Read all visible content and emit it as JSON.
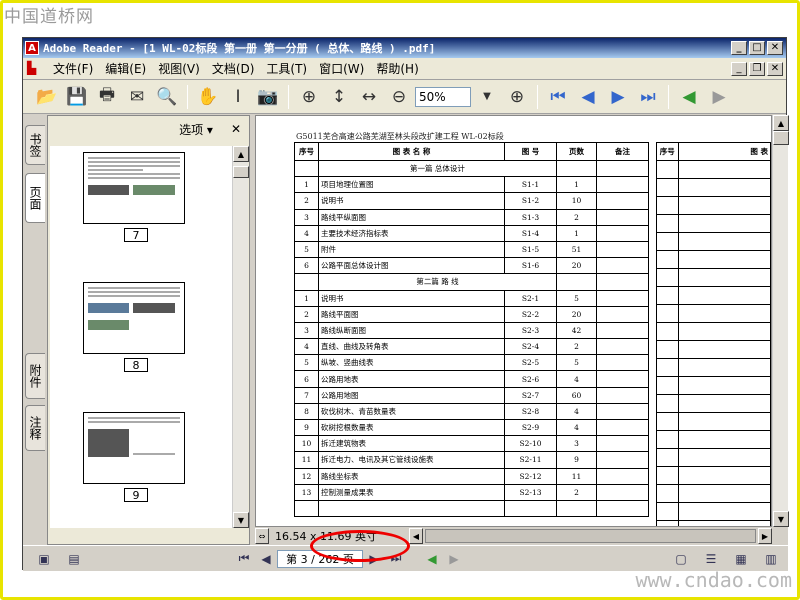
{
  "watermark": {
    "top": "中国道桥网",
    "bottom": "www.cndao.com"
  },
  "window": {
    "title": "Adobe Reader - [1 WL-02标段 第一册  第一分册 ( 总体、路线 ) .pdf]"
  },
  "menu": [
    {
      "label": "文件(F)"
    },
    {
      "label": "编辑(E)"
    },
    {
      "label": "视图(V)"
    },
    {
      "label": "文档(D)"
    },
    {
      "label": "工具(T)"
    },
    {
      "label": "窗口(W)"
    },
    {
      "label": "帮助(H)"
    }
  ],
  "toolbar": {
    "zoom": "50%"
  },
  "side_tabs": {
    "bookmarks": "书签",
    "pages": "页面",
    "attachments": "附件",
    "comments": "注释"
  },
  "side_panel": {
    "options": "选项",
    "close": "✕"
  },
  "thumbnails": [
    {
      "page": "7"
    },
    {
      "page": "8"
    },
    {
      "page": "9"
    }
  ],
  "document": {
    "header": "G5011芜合高速公路芜湖至林头段改扩建工程    WL-02标段",
    "columns": {
      "no": "序号",
      "name": "图   表   名   称",
      "code": "图   号",
      "pages": "页数",
      "note": "备注"
    },
    "sections": [
      {
        "title": "第一篇   总体设计",
        "rows": [
          {
            "no": "1",
            "name": "项目地理位置图",
            "code": "S1-1",
            "pages": "1"
          },
          {
            "no": "2",
            "name": "说明书",
            "code": "S1-2",
            "pages": "10"
          },
          {
            "no": "3",
            "name": "路线平纵面图",
            "code": "S1-3",
            "pages": "2"
          },
          {
            "no": "4",
            "name": "主要技术经济指标表",
            "code": "S1-4",
            "pages": "1"
          },
          {
            "no": "5",
            "name": "附件",
            "code": "S1-5",
            "pages": "51"
          },
          {
            "no": "6",
            "name": "公路平面总体设计图",
            "code": "S1-6",
            "pages": "20"
          }
        ]
      },
      {
        "title": "第二篇   路  线",
        "rows": [
          {
            "no": "1",
            "name": "说明书",
            "code": "S2-1",
            "pages": "5"
          },
          {
            "no": "2",
            "name": "路线平面图",
            "code": "S2-2",
            "pages": "20"
          },
          {
            "no": "3",
            "name": "路线纵断面图",
            "code": "S2-3",
            "pages": "42"
          },
          {
            "no": "4",
            "name": "直线、曲线及转角表",
            "code": "S2-4",
            "pages": "2"
          },
          {
            "no": "5",
            "name": "纵坡、竖曲线表",
            "code": "S2-5",
            "pages": "5"
          },
          {
            "no": "6",
            "name": "公路用地表",
            "code": "S2-6",
            "pages": "4"
          },
          {
            "no": "7",
            "name": "公路用地图",
            "code": "S2-7",
            "pages": "60"
          },
          {
            "no": "8",
            "name": "砍伐树木、青苗数量表",
            "code": "S2-8",
            "pages": "4"
          },
          {
            "no": "9",
            "name": "砍树挖根数量表",
            "code": "S2-9",
            "pages": "4"
          },
          {
            "no": "10",
            "name": "拆迁建筑物表",
            "code": "S2-10",
            "pages": "3"
          },
          {
            "no": "11",
            "name": "拆迁电力、电讯及其它管线设施表",
            "code": "S2-11",
            "pages": "9"
          },
          {
            "no": "12",
            "name": "路线坐标表",
            "code": "S2-12",
            "pages": "11"
          },
          {
            "no": "13",
            "name": "控制测量成果表",
            "code": "S2-13",
            "pages": "2"
          }
        ]
      }
    ],
    "right_columns": {
      "no": "序号",
      "name": "图   表"
    }
  },
  "status": {
    "dimensions": "16.54 x 11.69 英寸",
    "page_indicator": "第 3 / 262 页"
  }
}
